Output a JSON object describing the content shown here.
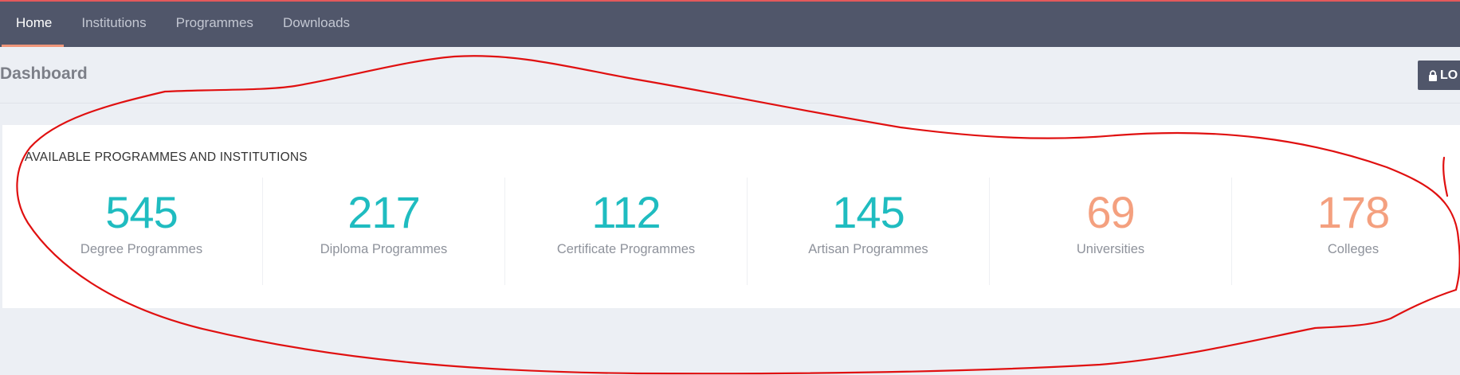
{
  "nav": {
    "tabs": [
      {
        "label": "Home",
        "active": true
      },
      {
        "label": "Institutions",
        "active": false
      },
      {
        "label": "Programmes",
        "active": false
      },
      {
        "label": "Downloads",
        "active": false
      }
    ]
  },
  "header": {
    "title": "Dashboard",
    "lock_button_label": "LO"
  },
  "stats": {
    "title": "AVAILABLE PROGRAMMES AND INSTITUTIONS",
    "items": [
      {
        "value": "545",
        "label": "Degree Programmes",
        "color": "#1fbcc0"
      },
      {
        "value": "217",
        "label": "Diploma Programmes",
        "color": "#1fbcc0"
      },
      {
        "value": "112",
        "label": "Certificate Programmes",
        "color": "#1fbcc0"
      },
      {
        "value": "145",
        "label": "Artisan Programmes",
        "color": "#1fbcc0"
      },
      {
        "value": "69",
        "label": "Universities",
        "color": "#f4a07f"
      },
      {
        "value": "178",
        "label": "Colleges",
        "color": "#f4a07f"
      }
    ]
  },
  "colors": {
    "navbar": "#50566a",
    "nav_active_indicator": "#f0967a",
    "top_accent": "#e4595b",
    "page_background": "#eceff4",
    "annotation_stroke": "#e01010"
  },
  "icons": {
    "lock_button": "lock-icon"
  }
}
